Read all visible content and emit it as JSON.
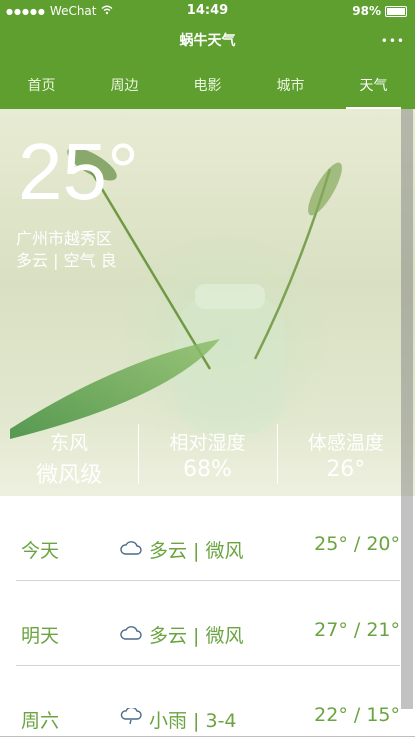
{
  "status": {
    "carrier": "WeChat",
    "time": "14:49",
    "battery": "98%"
  },
  "app": {
    "title": "蜗牛天气",
    "more": "•••"
  },
  "tabs": [
    {
      "label": "首页"
    },
    {
      "label": "周边"
    },
    {
      "label": "电影"
    },
    {
      "label": "城市"
    },
    {
      "label": "天气"
    }
  ],
  "current": {
    "temperature": "25°",
    "location": "广州市越秀区",
    "summary": "多云 | 空气 良"
  },
  "stats": [
    {
      "label": "东风",
      "value": "微风级"
    },
    {
      "label": "相对湿度",
      "value": "68%"
    },
    {
      "label": "体感温度",
      "value": "26°"
    }
  ],
  "forecast": [
    {
      "day": "今天",
      "icon": "cloud-icon",
      "condition": "多云 | 微风",
      "range": "25° / 20°"
    },
    {
      "day": "明天",
      "icon": "cloud-icon",
      "condition": "多云 | 微风",
      "range": "27° / 21°"
    },
    {
      "day": "周六",
      "icon": "rain-icon",
      "condition": "小雨 | 3-4",
      "range": "22° / 15°"
    }
  ],
  "colors": {
    "brand": "#5e9f2f",
    "accent": "#6aa441"
  }
}
